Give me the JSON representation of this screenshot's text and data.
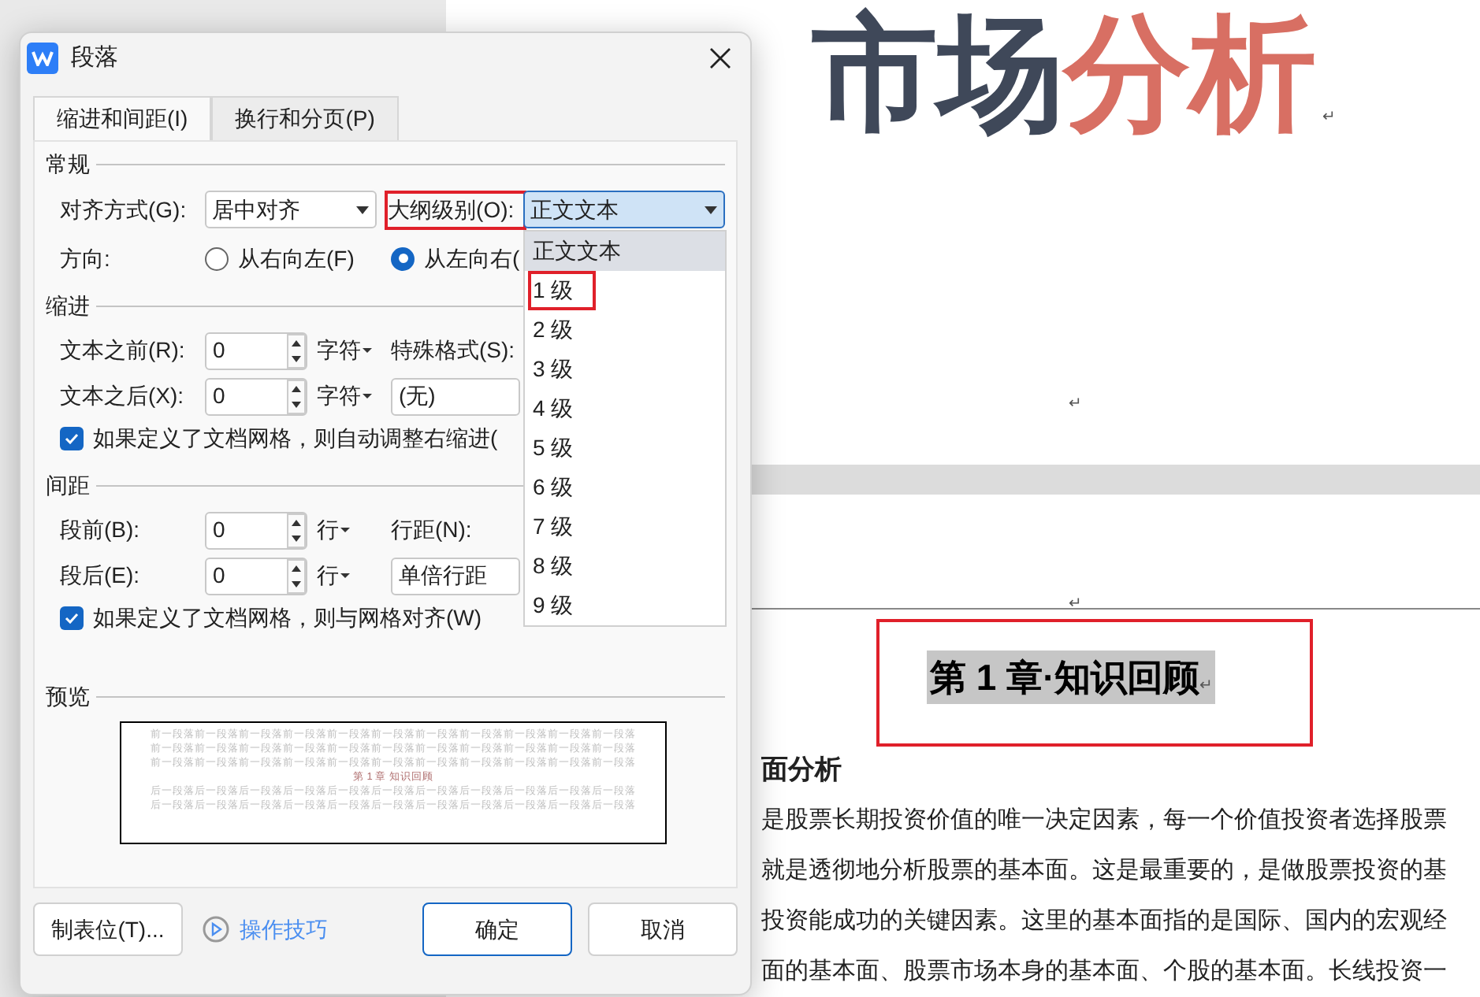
{
  "document": {
    "title_dark": "市场",
    "title_red": "分析",
    "marks": [
      "↵",
      "↵",
      "↵"
    ],
    "heading": {
      "text": "第 1 章·知识回顾",
      "mark": "↵",
      "highlighted": true
    },
    "subheading": "面分析",
    "paragraph_lines": [
      "是股票长期投资价值的唯一决定因素，每一个价值投资者选择股票",
      "就是透彻地分析股票的基本面。这是最重要的，是做股票投资的基",
      "投资能成功的关键因素。这里的基本面指的是国际、国内的宏观经",
      "面的基本面、股票市场本身的基本面、个股的基本面。长线投资一"
    ]
  },
  "dialog": {
    "title": "段落",
    "tabs": [
      {
        "label": "缩进和间距(I)",
        "selected": true
      },
      {
        "label": "换行和分页(P)",
        "selected": false
      }
    ],
    "general": {
      "heading": "常规",
      "alignment_label": "对齐方式(G):",
      "alignment_value": "居中对齐",
      "outline_label": "大纲级别(O):",
      "outline_label_highlighted": true,
      "outline_value": "正文文本",
      "direction_label": "方向:",
      "directions": [
        {
          "label": "从右向左(F)",
          "selected": false
        },
        {
          "label": "从左向右(",
          "selected": true
        }
      ]
    },
    "indent": {
      "heading": "缩进",
      "before_label": "文本之前(R):",
      "before_value": "0",
      "before_unit": "字符",
      "after_label": "文本之后(X):",
      "after_value": "0",
      "after_unit": "字符",
      "special_label": "特殊格式(S):",
      "special_value": "(无)",
      "auto_adjust": {
        "label": "如果定义了文档网格，则自动调整右缩进(",
        "checked": true
      }
    },
    "spacing": {
      "heading": "间距",
      "before_label": "段前(B):",
      "before_value": "0",
      "before_unit": "行",
      "after_label": "段后(E):",
      "after_value": "0",
      "after_unit": "行",
      "line_label": "行距(N):",
      "line_value": "单倍行距",
      "snap": {
        "label": "如果定义了文档网格，则与网格对齐(W)",
        "checked": true
      }
    },
    "preview": {
      "heading": "预览",
      "before_lines": [
        "前一段落前一段落前一段落前一段落前一段落前一段落前一段落前一段落前一段落前一段落前一段落",
        "前一段落前一段落前一段落前一段落前一段落前一段落前一段落前一段落前一段落前一段落前一段落",
        "前一段落前一段落前一段落前一段落前一段落前一段落前一段落前一段落前一段落前一段落前一段落"
      ],
      "sample": "第 1 章  知识回顾",
      "after_lines": [
        "后一段落后一段落后一段落后一段落后一段落后一段落后一段落后一段落后一段落后一段落后一段落",
        "后一段落后一段落后一段落后一段落后一段落后一段落后一段落后一段落后一段落后一段落后一段落"
      ]
    },
    "tabs_button": "制表位(T)...",
    "tips_link": "操作技巧",
    "ok": "确定",
    "cancel": "取消"
  },
  "outline_dropdown": [
    {
      "label": "正文文本",
      "selected": true,
      "highlighted": false
    },
    {
      "label": "1 级",
      "selected": false,
      "highlighted": true
    },
    {
      "label": "2 级",
      "selected": false,
      "highlighted": false
    },
    {
      "label": "3 级",
      "selected": false,
      "highlighted": false
    },
    {
      "label": "4 级",
      "selected": false,
      "highlighted": false
    },
    {
      "label": "5 级",
      "selected": false,
      "highlighted": false
    },
    {
      "label": "6 级",
      "selected": false,
      "highlighted": false
    },
    {
      "label": "7 级",
      "selected": false,
      "highlighted": false
    },
    {
      "label": "8 级",
      "selected": false,
      "highlighted": false
    },
    {
      "label": "9 级",
      "selected": false,
      "highlighted": false
    }
  ]
}
